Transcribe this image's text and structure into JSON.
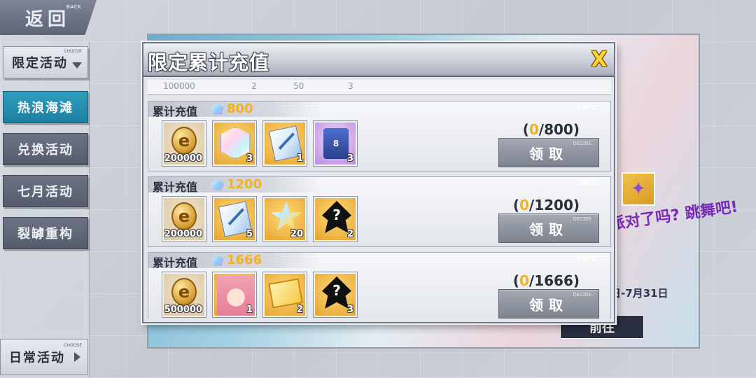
{
  "nav": {
    "back_label": "返回",
    "back_sub": "BACK",
    "dropdown_label": "限定活动",
    "dropdown_sub": "CHOOSE",
    "items": [
      {
        "label": "热浪海滩",
        "active": true
      },
      {
        "label": "兑换活动",
        "active": false
      },
      {
        "label": "七月活动",
        "active": false
      },
      {
        "label": "裂罅重构",
        "active": false
      }
    ],
    "daily_label": "日常活动",
    "daily_sub": "CHOOSE"
  },
  "background": {
    "banner_text": "派对了吗? 跳舞吧!",
    "date_text": "日-7月31日",
    "goto_label": "前往"
  },
  "dialog": {
    "title": "限定累计充值",
    "close_label": "X",
    "partial_row": {
      "values": [
        "100000",
        "2",
        "50",
        "3"
      ]
    },
    "rows": [
      {
        "label": "累计充值",
        "amount": "800",
        "info": "INFO",
        "progress_current": "0",
        "progress_total": "/800)",
        "progress_open": "(",
        "claim_label": "领取",
        "claim_sub": "DECIDE",
        "rewards": [
          {
            "icon": "coin-icon",
            "qty": "200000"
          },
          {
            "icon": "rainbow-crystal-icon",
            "qty": "3"
          },
          {
            "icon": "manual-book-icon",
            "qty": "1"
          },
          {
            "icon": "supply-bag-icon",
            "qty": "3"
          }
        ]
      },
      {
        "label": "累计充值",
        "amount": "1200",
        "info": "INFO",
        "progress_current": "0",
        "progress_total": "/1200)",
        "progress_open": "(",
        "claim_label": "领取",
        "claim_sub": "DECIDE",
        "rewards": [
          {
            "icon": "coin-icon",
            "qty": "200000"
          },
          {
            "icon": "manual-book-icon",
            "qty": "5"
          },
          {
            "icon": "star-shard-icon",
            "qty": "20"
          },
          {
            "icon": "mystery-item-icon",
            "qty": "2"
          }
        ]
      },
      {
        "label": "累计充值",
        "amount": "1666",
        "info": "INFO",
        "progress_current": "0",
        "progress_total": "/1666)",
        "progress_open": "(",
        "claim_label": "领取",
        "claim_sub": "DECIDE",
        "rewards": [
          {
            "icon": "coin-icon",
            "qty": "500000"
          },
          {
            "icon": "character-portrait-icon",
            "qty": "1"
          },
          {
            "icon": "tickets-icon",
            "qty": "2"
          },
          {
            "icon": "mystery-item-icon",
            "qty": "3"
          }
        ]
      }
    ]
  },
  "colors": {
    "accent_gold": "#f4b21c",
    "active_tab": "#2f9fbf",
    "close_x": "#ffd23a"
  }
}
